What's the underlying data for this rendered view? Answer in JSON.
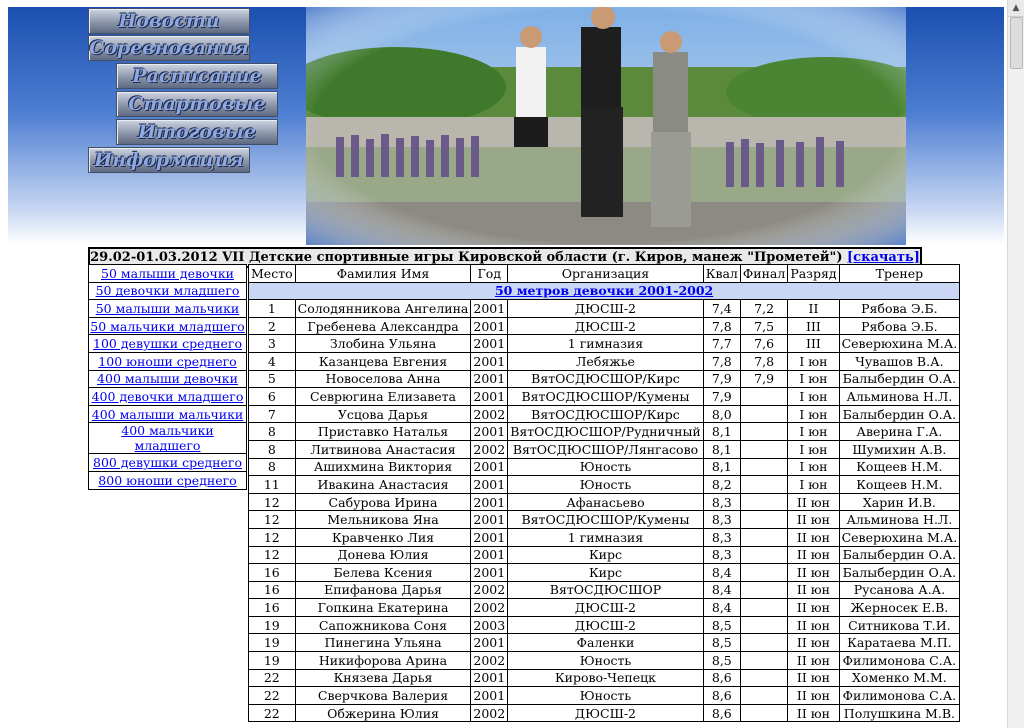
{
  "nav": {
    "items": [
      {
        "label": "Новости"
      },
      {
        "label": "Соревнования"
      },
      {
        "label": "Расписание"
      },
      {
        "label": "Стартовые"
      },
      {
        "label": "Итоговые"
      },
      {
        "label": "Информация"
      }
    ]
  },
  "header": {
    "title": "29.02-01.03.2012 VII Детские спортивные игры Кировской области (г. Киров, манеж \"Прометей\")",
    "download_label": "[скачать]"
  },
  "sidebar": {
    "items": [
      "50 малыши девочки",
      "50 девочки младшего",
      "50 малыши мальчики",
      "50 мальчики младшего",
      "100 девушки среднего",
      "100 юноши среднего",
      "400 малыши девочки",
      "400 девочки младшего",
      "400 малыши мальчики",
      "400 мальчики младшего",
      "800 девушки среднего",
      "800 юноши среднего"
    ]
  },
  "results": {
    "columns": [
      "Место",
      "Фамилия Имя",
      "Год",
      "Организация",
      "Квал",
      "Финал",
      "Разряд",
      "Тренер"
    ],
    "group_title": "50 метров девочки 2001-2002",
    "rows": [
      [
        "1",
        "Солодянникова Ангелина",
        "2001",
        "ДЮСШ-2",
        "7,4",
        "7,2",
        "II",
        "Рябова Э.Б."
      ],
      [
        "2",
        "Гребенева Александра",
        "2001",
        "ДЮСШ-2",
        "7,8",
        "7,5",
        "III",
        "Рябова Э.Б."
      ],
      [
        "3",
        "Злобина Ульяна",
        "2001",
        "1 гимназия",
        "7,7",
        "7,6",
        "III",
        "Северюхина М.А."
      ],
      [
        "4",
        "Казанцева Евгения",
        "2001",
        "Лебяжье",
        "7,8",
        "7,8",
        "I юн",
        "Чувашов В.А."
      ],
      [
        "5",
        "Новоселова Анна",
        "2001",
        "ВятОСДЮСШОР/Кирс",
        "7,9",
        "7,9",
        "I юн",
        "Балыбердин О.А."
      ],
      [
        "6",
        "Севрюгина Елизавета",
        "2001",
        "ВятОСДЮСШОР/Кумены",
        "7,9",
        "",
        "I юн",
        "Альминова Н.Л."
      ],
      [
        "7",
        "Усцова Дарья",
        "2002",
        "ВятОСДЮСШОР/Кирс",
        "8,0",
        "",
        "I юн",
        "Балыбердин О.А."
      ],
      [
        "8",
        "Приставко Наталья",
        "2001",
        "ВятОСДЮСШОР/Рудничный",
        "8,1",
        "",
        "I юн",
        "Аверина Г.А."
      ],
      [
        "8",
        "Литвинова Анастасия",
        "2002",
        "ВятОСДЮСШОР/Лянгасово",
        "8,1",
        "",
        "I юн",
        "Шумихин А.В."
      ],
      [
        "8",
        "Ашихмина Виктория",
        "2001",
        "Юность",
        "8,1",
        "",
        "I юн",
        "Кощеев Н.М."
      ],
      [
        "11",
        "Ивакина Анастасия",
        "2001",
        "Юность",
        "8,2",
        "",
        "I юн",
        "Кощеев Н.М."
      ],
      [
        "12",
        "Сабурова Ирина",
        "2001",
        "Афанасьево",
        "8,3",
        "",
        "II юн",
        "Харин И.В."
      ],
      [
        "12",
        "Мельникова Яна",
        "2001",
        "ВятОСДЮСШОР/Кумены",
        "8,3",
        "",
        "II юн",
        "Альминова Н.Л."
      ],
      [
        "12",
        "Кравченко Лия",
        "2001",
        "1 гимназия",
        "8,3",
        "",
        "II юн",
        "Северюхина М.А."
      ],
      [
        "12",
        "Донева Юлия",
        "2001",
        "Кирс",
        "8,3",
        "",
        "II юн",
        "Балыбердин О.А."
      ],
      [
        "16",
        "Белева Ксения",
        "2001",
        "Кирс",
        "8,4",
        "",
        "II юн",
        "Балыбердин О.А."
      ],
      [
        "16",
        "Епифанова Дарья",
        "2002",
        "ВятОСДЮСШОР",
        "8,4",
        "",
        "II юн",
        "Русанова А.А."
      ],
      [
        "16",
        "Гопкина Екатерина",
        "2002",
        "ДЮСШ-2",
        "8,4",
        "",
        "II юн",
        "Жерносек Е.В."
      ],
      [
        "19",
        "Сапожникова Соня",
        "2003",
        "ДЮСШ-2",
        "8,5",
        "",
        "II юн",
        "Ситникова Т.И."
      ],
      [
        "19",
        "Пинегина Ульяна",
        "2001",
        "Фаленки",
        "8,5",
        "",
        "II юн",
        "Каратаева М.П."
      ],
      [
        "19",
        "Никифорова Арина",
        "2002",
        "Юность",
        "8,5",
        "",
        "II юн",
        "Филимонова С.А."
      ],
      [
        "22",
        "Князева Дарья",
        "2001",
        "Кирово-Чепецк",
        "8,6",
        "",
        "II юн",
        "Хоменко М.М."
      ],
      [
        "22",
        "Сверчкова Валерия",
        "2001",
        "Юность",
        "8,6",
        "",
        "II юн",
        "Филимонова С.А."
      ],
      [
        "22",
        "Обжерина Юлия",
        "2002",
        "ДЮСШ-2",
        "8,6",
        "",
        "II юн",
        "Полушкина М.В."
      ]
    ]
  }
}
